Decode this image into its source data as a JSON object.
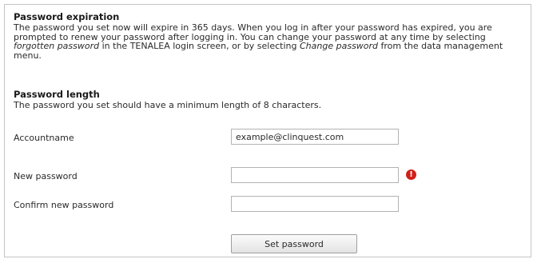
{
  "expiration": {
    "heading": "Password expiration",
    "text_1": "The password you set now will expire in 365 days. When you log in after your password has expired, you are prompted to renew your password after logging in. You can change your password at any time by selecting ",
    "link_forgotten": "forgotten password",
    "text_2": " in the TENALEA login screen, or by selecting ",
    "link_change": "Change password",
    "text_3": " from the data management menu."
  },
  "length": {
    "heading": "Password length",
    "text": "The password you set should have a minimum length of 8 characters."
  },
  "form": {
    "account_label": "Accountname",
    "account_value": "example@clinquest.com",
    "new_password_label": "New password",
    "confirm_password_label": "Confirm new password",
    "error_icon": "!",
    "submit_label": "Set password"
  },
  "colors": {
    "error": "#d0201a",
    "border": "#c4c4c4"
  }
}
